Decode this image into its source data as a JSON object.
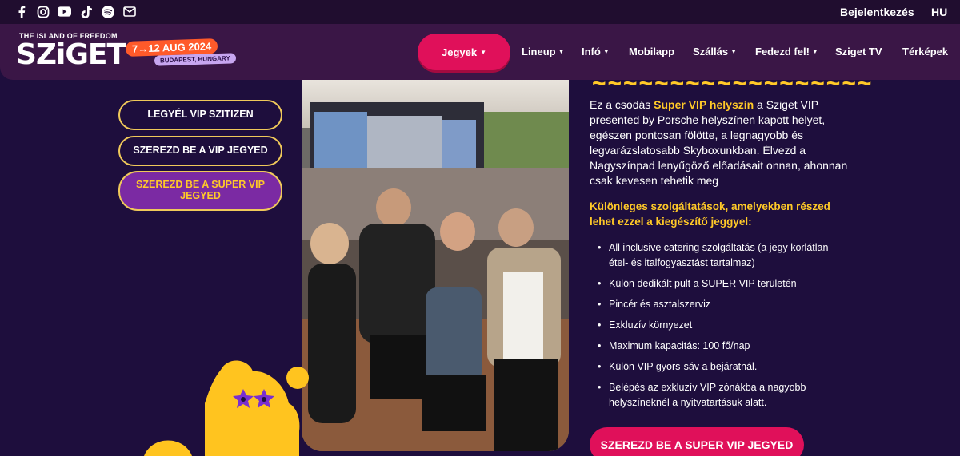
{
  "header": {
    "social_icons": [
      "facebook-icon",
      "instagram-icon",
      "youtube-icon",
      "tiktok-icon",
      "spotify-icon",
      "mail-icon"
    ],
    "login_label": "Bejelentkezés",
    "language": "HU"
  },
  "logo": {
    "tagline": "THE ISLAND OF FREEDOM",
    "wordmark": "SZiGET",
    "dates": "7→12 AUG 2024",
    "location": "BUDAPEST, HUNGARY"
  },
  "nav": {
    "tickets_label": "Jegyek",
    "items": [
      "Lineup",
      "Infó",
      "Mobilapp",
      "Szállás",
      "Fedezd fel!",
      "Sziget TV",
      "Térképek"
    ]
  },
  "side_buttons": [
    "LEGYÉL VIP SZITIZEN",
    "SZEREZD BE A VIP JEGYED",
    "SZEREZD BE A SUPER VIP JEGYED"
  ],
  "content": {
    "intro_before": "Ez a csodás ",
    "intro_highlight": "Super VIP helyszín",
    "intro_after": " a Sziget VIP presented by Porsche helyszínen kapott helyet, egészen pontosan fölötte, a legnagyobb és legvarázslatosabb Skyboxunkban. Élvezd a Nagyszínpad lenyűgöző előadásait onnan, ahonnan csak kevesen tehetik meg",
    "subheading": "Különleges szolgáltatások, amelyekben részed lehet ezzel a kiegészítő jeggyel:",
    "features": [
      "All inclusive catering szolgáltatás (a jegy korlátlan étel- és italfogyasztást tartalmaz)",
      "Külön dedikált pult a SUPER VIP területén",
      "Pincér és asztalszerviz",
      "Exkluzív környezet",
      "Maximum kapacitás: 100 fő/nap",
      "Külön VIP gyors-sáv a bejáratnál.",
      "Belépés az exkluzív VIP zónákba a nagyobb helyszíneknél a nyitvatartásuk alatt."
    ],
    "cta_label": "SZEREZD BE A SUPER VIP JEGYED"
  },
  "colors": {
    "background": "#1e0e3d",
    "topbar": "#200d2f",
    "navbar": "#3a1646",
    "accent_pink": "#e0105a",
    "accent_yellow": "#ffc928",
    "active_pill": "#7b2aa3"
  }
}
